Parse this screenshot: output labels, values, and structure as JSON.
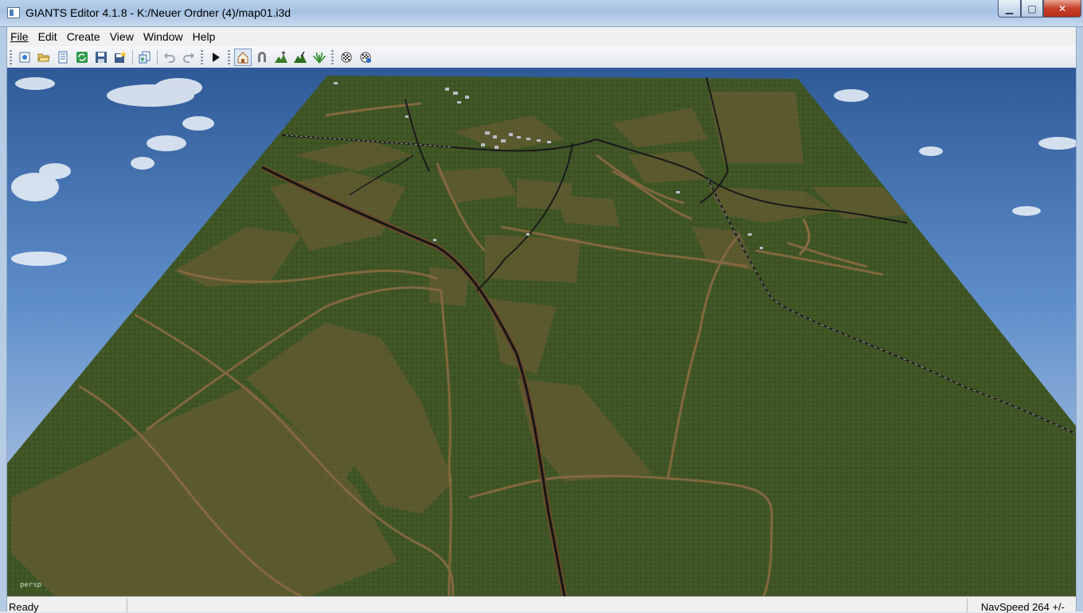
{
  "window": {
    "title": "GIANTS Editor 4.1.8 - K:/Neuer Ordner (4)/map01.i3d",
    "min_glyph": "▁",
    "max_glyph": "□",
    "close_glyph": "✕"
  },
  "menu": [
    {
      "label": "File",
      "accel": "F"
    },
    {
      "label": "Edit",
      "accel": "E"
    },
    {
      "label": "Create",
      "accel": "C"
    },
    {
      "label": "View",
      "accel": "V"
    },
    {
      "label": "Window",
      "accel": "W"
    },
    {
      "label": "Help",
      "accel": "H"
    }
  ],
  "toolbar": {
    "buttons": [
      {
        "icon": "new-scene-icon"
      },
      {
        "icon": "open-icon"
      },
      {
        "icon": "document-list-icon"
      },
      {
        "icon": "reload-icon"
      },
      {
        "icon": "save-icon"
      },
      {
        "icon": "save-all-icon"
      },
      {
        "icon": "import-icon"
      },
      {
        "icon": "undo-icon"
      },
      {
        "icon": "redo-icon"
      },
      {
        "icon": "play-icon"
      },
      {
        "icon": "select-mode-icon",
        "active": true
      },
      {
        "icon": "move-mode-icon"
      },
      {
        "icon": "terrain-sculpt-icon"
      },
      {
        "icon": "terrain-paint-icon"
      },
      {
        "icon": "foliage-paint-icon"
      },
      {
        "icon": "render-settings-icon"
      },
      {
        "icon": "lod-settings-icon"
      }
    ]
  },
  "viewport": {
    "camera_label": "persp",
    "sky_color": "#4c7fc0",
    "terrain_color": "#3e5424",
    "field_color": "#5e5a2e",
    "road_color": "#8a6a42",
    "rail_color": "#1b1b1b"
  },
  "status": {
    "left": "Ready",
    "right": "NavSpeed 264 +/-"
  }
}
